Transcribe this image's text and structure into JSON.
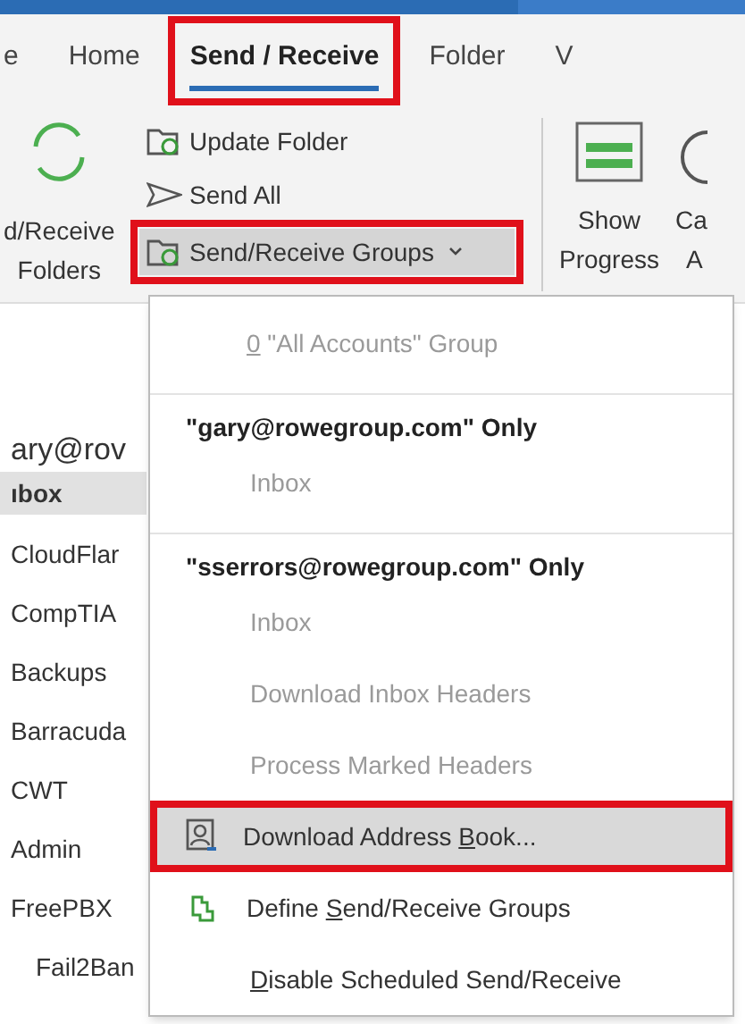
{
  "tabs": [
    {
      "label": "e",
      "selected": false,
      "annotated": false
    },
    {
      "label": "Home",
      "selected": false,
      "annotated": false
    },
    {
      "label": "Send / Receive",
      "selected": true,
      "annotated": true
    },
    {
      "label": "Folder",
      "selected": false,
      "annotated": false
    },
    {
      "label": "V",
      "selected": false,
      "annotated": false
    }
  ],
  "ribbon": {
    "big_button": [
      "d/Receive",
      "Folders"
    ],
    "small_buttons": [
      {
        "kind": "update",
        "label": "Update Folder",
        "annotated": false
      },
      {
        "kind": "send",
        "label": "Send All",
        "annotated": false
      },
      {
        "kind": "groups",
        "label": "Send/Receive Groups",
        "annotated": true
      }
    ],
    "progress_button": [
      "Show",
      "Progress"
    ],
    "cut_button": [
      "Ca",
      "A"
    ]
  },
  "folder_pane": {
    "account": "ary@rov",
    "items": [
      {
        "label": "ıbox",
        "selected": true,
        "nested": false
      },
      {
        "label": "CloudFlar",
        "selected": false,
        "nested": false
      },
      {
        "label": "CompTIA",
        "selected": false,
        "nested": false
      },
      {
        "label": "Backups",
        "selected": false,
        "nested": false
      },
      {
        "label": "Barracuda",
        "selected": false,
        "nested": false
      },
      {
        "label": "CWT",
        "selected": false,
        "nested": false
      },
      {
        "label": "Admin",
        "selected": false,
        "nested": false
      },
      {
        "label": "FreePBX",
        "selected": false,
        "nested": false
      },
      {
        "label": "Fail2Ban",
        "selected": false,
        "nested": true
      }
    ]
  },
  "menu": [
    {
      "kind": "entry",
      "key": "0",
      "after": " \"All Accounts\" Group",
      "disabled": true,
      "selected": false,
      "annotated": false
    },
    {
      "kind": "separator"
    },
    {
      "kind": "header",
      "before": "\"gary@rowegroup.com\" Only"
    },
    {
      "kind": "sub",
      "before": "Inbox",
      "disabled": true,
      "selected": false,
      "annotated": false
    },
    {
      "kind": "separator"
    },
    {
      "kind": "header",
      "before": "\"sserrors@rowegroup.com\" Only"
    },
    {
      "kind": "sub",
      "before": "Inbox",
      "disabled": true,
      "selected": false,
      "annotated": false
    },
    {
      "kind": "sub",
      "before": "Download Inbox Headers",
      "disabled": true,
      "selected": false,
      "annotated": false
    },
    {
      "kind": "sub",
      "before": "Process Marked Headers",
      "disabled": true,
      "selected": false,
      "annotated": false
    },
    {
      "kind": "address",
      "before": "Download Address ",
      "key": "B",
      "after": "ook...",
      "disabled": false,
      "selected": true,
      "annotated": true
    },
    {
      "kind": "define",
      "before": "Define ",
      "key": "S",
      "after": "end/Receive Groups",
      "disabled": false,
      "selected": false,
      "annotated": false
    },
    {
      "kind": "plain",
      "key": "D",
      "after": "isable Scheduled Send/Receive",
      "disabled": false,
      "selected": false,
      "annotated": false
    }
  ]
}
